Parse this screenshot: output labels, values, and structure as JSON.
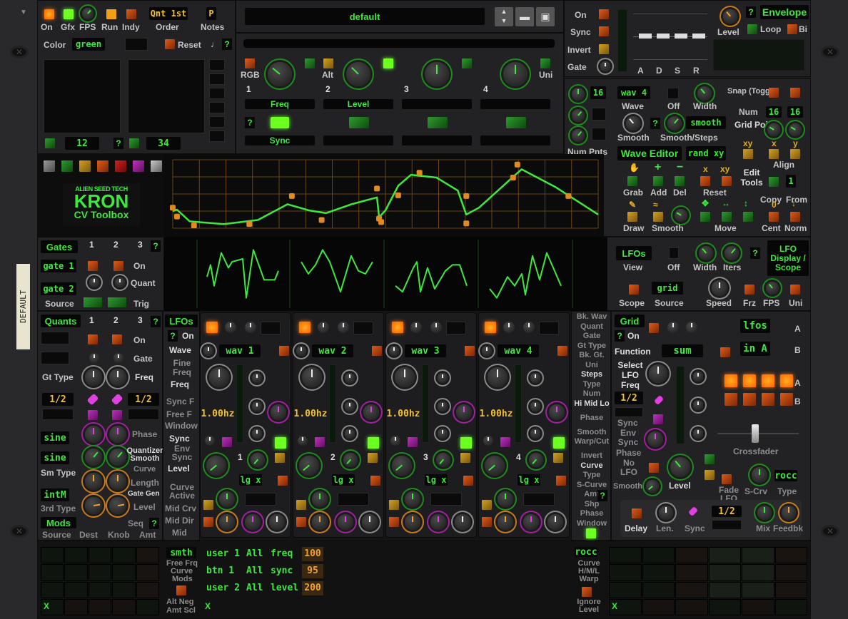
{
  "device": {
    "brand": "ALIEN SEED TECH",
    "name": "KRON",
    "subtitle": "CV Toolbox",
    "tape_label": "DEFAULT"
  },
  "top_left": {
    "on": "On",
    "gfx": "Gfx",
    "fps": "FPS",
    "run": "Run",
    "indy": "Indy",
    "order_value": "Qnt 1st",
    "order_label": "Order",
    "notes_value": "P",
    "notes_label": "Notes",
    "color_label": "Color",
    "color_value": "green",
    "reset_label": "Reset",
    "note_glyph": "♩",
    "help": "?"
  },
  "pads": {
    "pad1_value": "12",
    "pad2_value": "34",
    "help": "?"
  },
  "color_swatches": [
    "gray",
    "green",
    "yellow",
    "orange",
    "red",
    "purple",
    "light-gray"
  ],
  "preset": {
    "name": "default"
  },
  "macro": {
    "rgb": "RGB",
    "alt": "Alt",
    "uni": "Uni",
    "knobs": [
      {
        "num": "1",
        "target": "Freq",
        "button": "Sync"
      },
      {
        "num": "2",
        "target": "Level",
        "button": ""
      },
      {
        "num": "3",
        "target": "",
        "button": ""
      },
      {
        "num": "4",
        "target": "",
        "button": ""
      }
    ],
    "help": "?"
  },
  "envelope": {
    "on": "On",
    "sync": "Sync",
    "invert": "Invert",
    "gate": "Gate",
    "sliders": [
      "A",
      "D",
      "S",
      "R"
    ],
    "level": "Level",
    "title": "Envelope",
    "loop": "Loop",
    "bi": "Bi",
    "help": "?"
  },
  "wave_editor": {
    "num_value": "16",
    "num_pnts": "Num Pnts",
    "wave_value": "wav 4",
    "wave_label": "Wave",
    "off": "Off",
    "width": "Width",
    "smooth": "Smooth",
    "smooth_steps_value": "smooth",
    "smooth_steps_label": "Smooth/Steps",
    "title": "Wave Editor",
    "rand": "rand xy",
    "help": "?",
    "snap": "Snap (Toggle)",
    "num": "Num",
    "grid_x": "16",
    "grid_y": "16",
    "grid_points": "Grid Points",
    "xy": "xy",
    "x": "x",
    "y": "y",
    "align": "Align",
    "grab": "Grab",
    "add": "Add",
    "del": "Del",
    "reset": "Reset",
    "reset_x": "x",
    "reset_xy": "xy",
    "edit_tools": "Edit Tools",
    "copy": "Copy",
    "from": "From",
    "from_value": "1",
    "draw": "Draw",
    "smooth2": "Smooth",
    "move": "Move",
    "cent": "Cent",
    "norm": "Norm",
    "cent_glyph": "0"
  },
  "wave_points": [
    [
      0.0,
      0.3
    ],
    [
      0.01,
      0.17
    ],
    [
      0.05,
      0.04
    ],
    [
      0.18,
      0.06
    ],
    [
      0.28,
      0.47
    ],
    [
      0.35,
      0.12
    ],
    [
      0.48,
      0.58
    ],
    [
      0.485,
      0.14
    ],
    [
      0.49,
      0.09
    ],
    [
      0.53,
      0.48
    ],
    [
      0.58,
      0.81
    ],
    [
      0.69,
      0.47
    ],
    [
      0.69,
      0.07
    ],
    [
      0.8,
      0.74
    ],
    [
      0.81,
      0.93
    ],
    [
      0.93,
      0.47
    ]
  ],
  "gates": {
    "title": "Gates",
    "cols": [
      "1",
      "2",
      "3"
    ],
    "help": "?",
    "gate1": "gate 1",
    "gate2": "gate 2",
    "on": "On",
    "quant": "Quant",
    "source": "Source",
    "trig": "Trig"
  },
  "scope": {
    "view_value": "LFOs",
    "view": "View",
    "off": "Off",
    "width": "Width",
    "iters": "Iters",
    "help": "?",
    "title": "LFO Display / Scope",
    "scope": "Scope",
    "source_value": "grid",
    "source": "Source",
    "speed": "Speed",
    "frz": "Frz",
    "fps": "FPS",
    "uni": "Uni"
  },
  "quants": {
    "title": "Quants",
    "cols": [
      "1",
      "2",
      "3"
    ],
    "help": "?",
    "on": "On",
    "gate": "Gate",
    "gt_type": "Gt Type",
    "freq": "Freq",
    "ratio_left": "1/2",
    "ratio_right": "1/2",
    "phase": "Phase",
    "wave1": "sine",
    "wave2": "sine",
    "quantizer_smooth": "Quantizer Smooth",
    "sm_type": "Sm Type",
    "curve": "Curve",
    "length": "Length",
    "gate_gen": "Gate Gen",
    "third_value": "intM",
    "third_type": "3rd Type",
    "level": "Level",
    "mods": "Mods",
    "seq": "Seq",
    "source": "Source",
    "dest": "Dest",
    "knob": "Knob",
    "amt": "Amt"
  },
  "lfo_labels": {
    "title": "LFOs",
    "help": "?",
    "on": "On",
    "wave": "Wave",
    "fine_freq": "Fine Freq",
    "freq": "Freq",
    "sync_f": "Sync F",
    "free_f": "Free F",
    "window": "Window",
    "sync": "Sync",
    "env_sync": "Env Sync",
    "level": "Level",
    "curve_active": "Curve Active",
    "mid_crv": "Mid Crv",
    "mid_dir": "Mid Dir",
    "mid": "Mid"
  },
  "lfos": [
    {
      "wave": "wav 1",
      "freq": "1.00hz",
      "num": "1",
      "shape": "lg x"
    },
    {
      "wave": "wav 2",
      "freq": "1.00hz",
      "num": "2",
      "shape": "lg x"
    },
    {
      "wave": "wav 3",
      "freq": "1.00hz",
      "num": "3",
      "shape": "lg x"
    },
    {
      "wave": "wav 4",
      "freq": "1.00hz",
      "num": "4",
      "shape": "lg x"
    }
  ],
  "lfo_right_labels": [
    "Bk. Wav",
    "Quant",
    "Gate",
    "Gt Type",
    "Bk. Gt.",
    "Uni",
    "Steps",
    "Type",
    "Num",
    "Hi Mid Lo",
    "Phase",
    "Smooth",
    "Warp/Cut",
    "Invert",
    "Curve",
    "Type",
    "S-Curve",
    "Amt",
    "Shp",
    "Phase",
    "Window"
  ],
  "grid_mix": {
    "title": "Grid",
    "help": "?",
    "on": "On",
    "function": "Function",
    "function_value": "sum",
    "select_lfo_freq": "Select LFO Freq",
    "ratio": "1/2",
    "sync": "Sync",
    "env_sync": "Env Sync",
    "phase": "Phase",
    "no_lfo": "No LFO",
    "smooth": "Smooth",
    "level": "Level",
    "a_value": "lfos",
    "b_value": "in A",
    "a": "A",
    "b": "B",
    "crossfader": "Crossfader",
    "fade_lfo": "Fade LFO",
    "s_crv": "S-Crv",
    "type_value": "rocc",
    "type": "Type",
    "delay": "Delay",
    "len": "Len.",
    "delay_sync": "Sync",
    "delay_ratio": "1/2",
    "mix": "Mix",
    "feedbk": "Feedbk"
  },
  "mod_matrix": {
    "smth": "smth",
    "free_frq": "Free Frq",
    "curve": "Curve",
    "mods": "Mods",
    "alt_neg": "Alt Neg",
    "amt_scl": "Amt Scl",
    "x": "X",
    "rows": [
      {
        "source": "user 1",
        "scope": "All",
        "dest": "freq",
        "amount": "100"
      },
      {
        "source": "btn 1",
        "scope": "All",
        "dest": "sync",
        "amount": "95"
      },
      {
        "source": "user 2",
        "scope": "All",
        "dest": "level",
        "amount": "200"
      }
    ],
    "rocc": "rocc",
    "curve_hml_warp": "Curve H/M/L Warp",
    "ignore_level": "Ignore Level"
  }
}
